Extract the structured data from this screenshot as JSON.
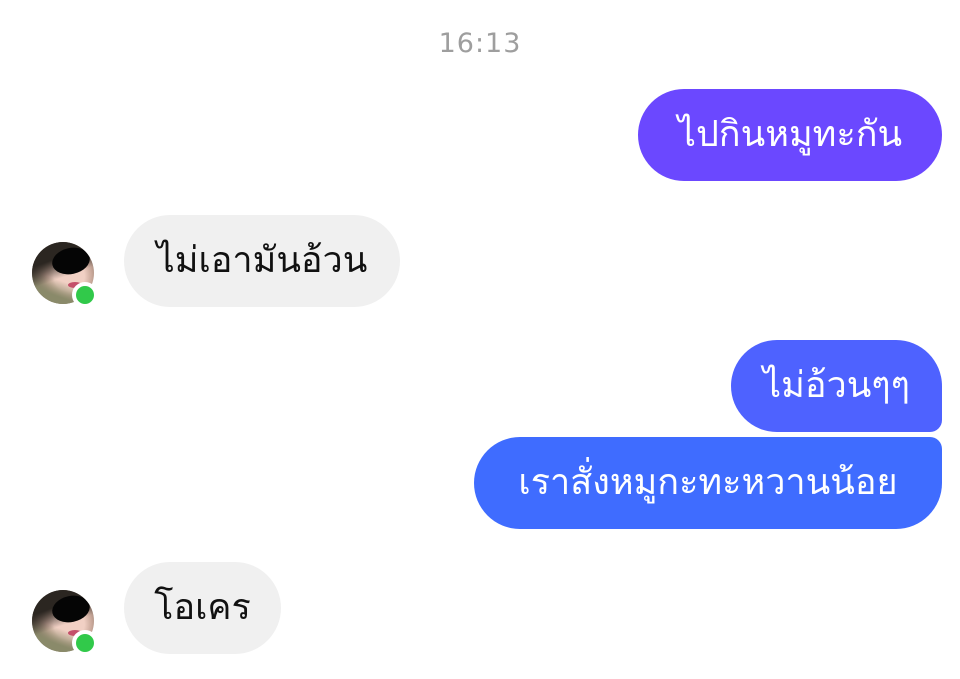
{
  "conversation": {
    "timestamp": "16:13",
    "messages": [
      {
        "direction": "outgoing",
        "text": "ไปกินหมูทะกัน",
        "color": "#6b48ff"
      },
      {
        "direction": "incoming",
        "text": "ไม่เอามันอ้วน",
        "avatar": "contact-avatar-icon",
        "online": true
      },
      {
        "direction": "outgoing",
        "text": "ไม่อ้วนๆๆ",
        "color": "#4e62ff"
      },
      {
        "direction": "outgoing",
        "text": "เราสั่งหมูกะทะหวานน้อย",
        "color": "#3f6cff"
      },
      {
        "direction": "incoming",
        "text": "โอเคร",
        "avatar": "contact-avatar-icon",
        "online": true
      }
    ]
  },
  "colors": {
    "incoming_bubble": "#f0f0f0",
    "online_status": "#31c94a",
    "timestamp": "#9e9e9e"
  }
}
